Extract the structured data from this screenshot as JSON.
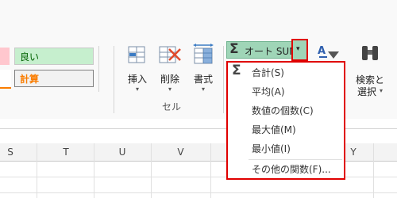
{
  "styles": {
    "good_label": "良い",
    "calc_label": "計算"
  },
  "cells_group": {
    "insert_label": "挿入",
    "delete_label": "削除",
    "format_label": "書式",
    "group_label": "セル"
  },
  "editing": {
    "autosum_label": "オート SUM",
    "search_label_line1": "検索と",
    "search_label_line2": "選択"
  },
  "autosum_menu": {
    "items": [
      {
        "label": "合計(S)"
      },
      {
        "label": "平均(A)"
      },
      {
        "label": "数値の個数(C)"
      },
      {
        "label": "最大値(M)"
      },
      {
        "label": "最小値(I)"
      },
      {
        "label": "その他の関数(F)..."
      }
    ]
  },
  "sheet": {
    "columns": [
      "S",
      "T",
      "U",
      "V",
      "Y"
    ]
  },
  "colors": {
    "highlight_red": "#e00000",
    "good_fill": "#c6efce",
    "good_text": "#006100",
    "calc_text": "#fa7d00",
    "autosum_fill": "#9fd5b7"
  }
}
